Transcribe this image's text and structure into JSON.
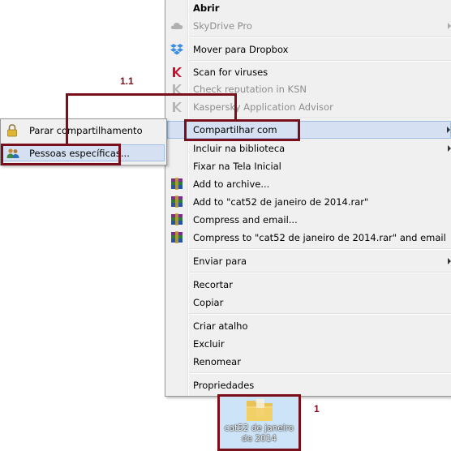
{
  "context_menu": {
    "items": [
      {
        "label": "Abrir",
        "bold": true
      },
      {
        "label": "SkyDrive Pro",
        "icon": "skydrive-icon",
        "disabled": true,
        "submenu": true
      },
      {
        "label": "Mover para Dropbox",
        "icon": "dropbox-icon"
      },
      {
        "label": "Scan for viruses",
        "icon": "kaspersky-icon"
      },
      {
        "label": "Check reputation in KSN",
        "icon": "kaspersky-icon",
        "disabled": true
      },
      {
        "label": "Kaspersky Application Advisor",
        "icon": "kaspersky-icon",
        "disabled": true
      },
      {
        "label": "Compartilhar com",
        "submenu": true,
        "highlighted": true
      },
      {
        "label": "Incluir na biblioteca",
        "submenu": true
      },
      {
        "label": "Fixar na Tela Inicial"
      },
      {
        "label": "Add to archive...",
        "icon": "winrar-icon"
      },
      {
        "label": "Add to \"cat52 de janeiro de 2014.rar\"",
        "icon": "winrar-icon"
      },
      {
        "label": "Compress and email...",
        "icon": "winrar-icon"
      },
      {
        "label": "Compress to \"cat52 de janeiro de 2014.rar\" and email",
        "icon": "winrar-icon"
      },
      {
        "label": "Enviar para",
        "submenu": true
      },
      {
        "label": "Recortar"
      },
      {
        "label": "Copiar"
      },
      {
        "label": "Criar atalho"
      },
      {
        "label": "Excluir"
      },
      {
        "label": "Renomear"
      },
      {
        "label": "Propriedades"
      }
    ]
  },
  "share_submenu": {
    "items": [
      {
        "label": "Parar compartilhamento",
        "icon": "lock-icon"
      },
      {
        "label": "Pessoas específicas...",
        "icon": "people-icon",
        "highlighted": true
      }
    ]
  },
  "folder": {
    "label": "cat52 de janeiro de 2014",
    "icon": "folder-icon"
  },
  "annotations": {
    "step1": "1",
    "step1_1": "1.1",
    "color": "#7a0f1c"
  }
}
